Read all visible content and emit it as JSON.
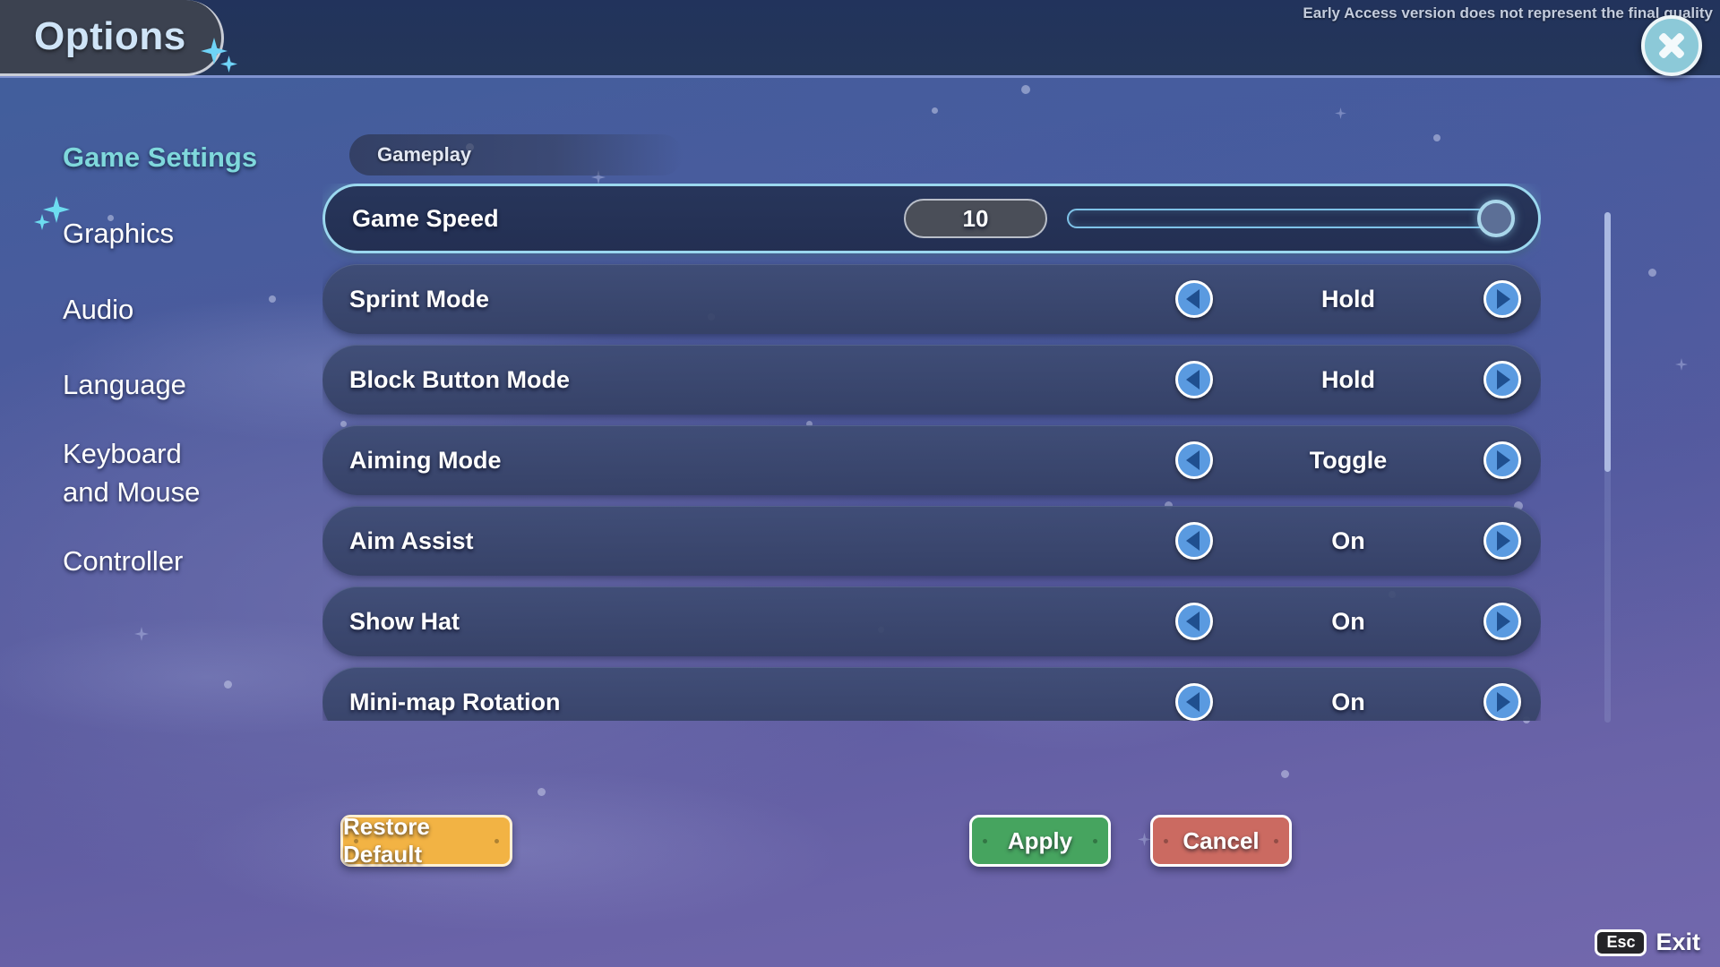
{
  "window": {
    "title": "Options",
    "early_access_note": "Early Access version does not represent the final quality",
    "close_icon": "close-icon"
  },
  "sidebar": {
    "items": [
      {
        "label": "Game Settings",
        "active": true
      },
      {
        "label": "Graphics",
        "active": false
      },
      {
        "label": "Audio",
        "active": false
      },
      {
        "label": "Language",
        "active": false
      },
      {
        "label": "Keyboard and Mouse",
        "active": false
      },
      {
        "label": "Controller",
        "active": false
      }
    ]
  },
  "main": {
    "section": "Gameplay",
    "rows": [
      {
        "label": "Game Speed",
        "type": "slider",
        "value": "10",
        "slider_percent": 100,
        "selected": true
      },
      {
        "label": "Sprint Mode",
        "type": "stepper",
        "value": "Hold",
        "selected": false
      },
      {
        "label": "Block Button Mode",
        "type": "stepper",
        "value": "Hold",
        "selected": false
      },
      {
        "label": "Aiming Mode",
        "type": "stepper",
        "value": "Toggle",
        "selected": false
      },
      {
        "label": "Aim Assist",
        "type": "stepper",
        "value": "On",
        "selected": false
      },
      {
        "label": "Show Hat",
        "type": "stepper",
        "value": "On",
        "selected": false
      },
      {
        "label": "Mini-map Rotation",
        "type": "stepper",
        "value": "On",
        "selected": false
      }
    ],
    "arrow_left_icon": "chevron-left-icon",
    "arrow_right_icon": "chevron-right-icon"
  },
  "footer": {
    "restore_label": "Restore Default",
    "apply_label": "Apply",
    "cancel_label": "Cancel",
    "esc_key": "Esc",
    "esc_action": "Exit"
  },
  "colors": {
    "accent_teal": "#7fd8dc",
    "restore_orange": "#f2b344",
    "apply_green": "#46a45f",
    "cancel_red": "#cb6a61",
    "arrow_blue": "#5a9ae0",
    "highlight_border": "#9bd8ef"
  }
}
